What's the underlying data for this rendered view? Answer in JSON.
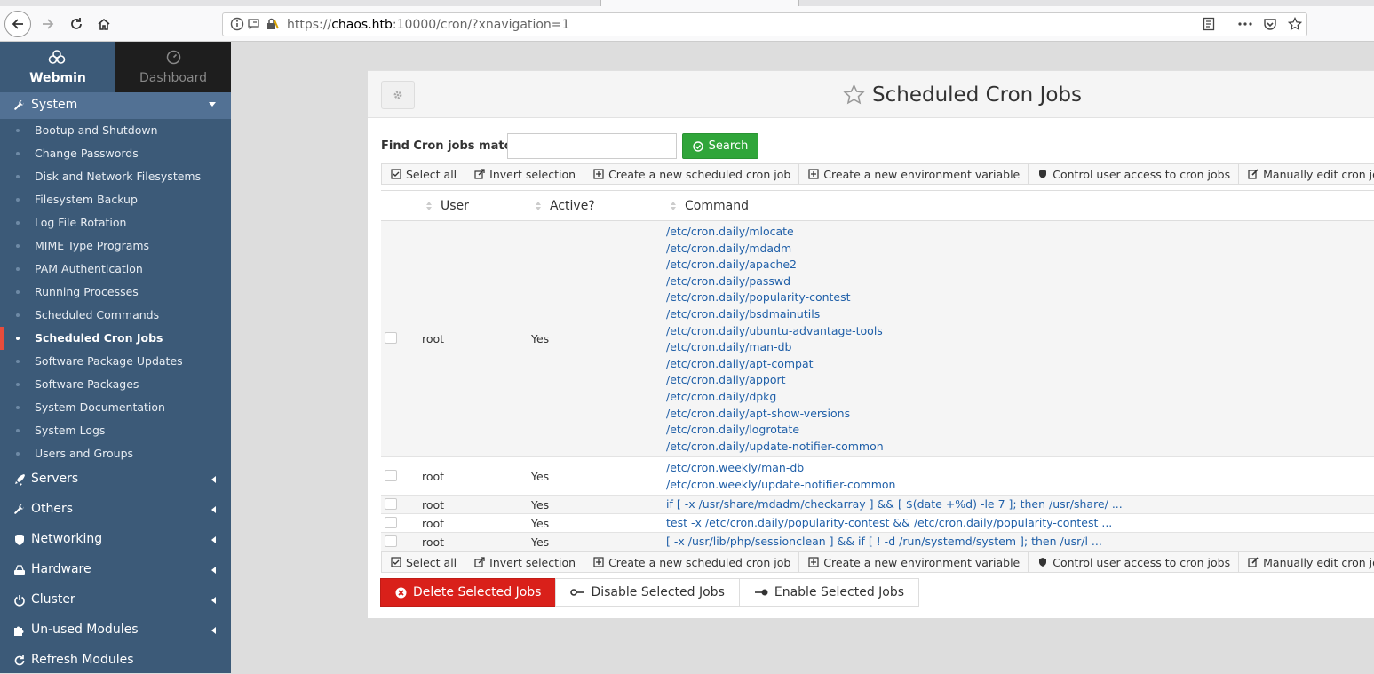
{
  "browser": {
    "url_scheme": "https://",
    "url_host": "chaos.htb",
    "url_rest": ":10000/cron/?xnavigation=1"
  },
  "sidebar": {
    "tab_webmin": "Webmin",
    "tab_dashboard": "Dashboard",
    "system_label": "System",
    "items": [
      {
        "label": "Bootup and Shutdown"
      },
      {
        "label": "Change Passwords"
      },
      {
        "label": "Disk and Network Filesystems"
      },
      {
        "label": "Filesystem Backup"
      },
      {
        "label": "Log File Rotation"
      },
      {
        "label": "MIME Type Programs"
      },
      {
        "label": "PAM Authentication"
      },
      {
        "label": "Running Processes"
      },
      {
        "label": "Scheduled Commands"
      },
      {
        "label": "Scheduled Cron Jobs"
      },
      {
        "label": "Software Package Updates"
      },
      {
        "label": "Software Packages"
      },
      {
        "label": "System Documentation"
      },
      {
        "label": "System Logs"
      },
      {
        "label": "Users and Groups"
      }
    ],
    "categories": [
      {
        "label": "Servers",
        "icon": "rocket-icon"
      },
      {
        "label": "Others",
        "icon": "wrench-icon"
      },
      {
        "label": "Networking",
        "icon": "shield-icon"
      },
      {
        "label": "Hardware",
        "icon": "hdd-icon"
      },
      {
        "label": "Cluster",
        "icon": "power-icon"
      },
      {
        "label": "Un-used Modules",
        "icon": "puzzle-icon"
      },
      {
        "label": "Refresh Modules",
        "icon": "refresh-icon"
      }
    ]
  },
  "main": {
    "title": "Scheduled Cron Jobs",
    "find_label": "Find Cron jobs matching",
    "search_value": "",
    "search_button": "Search",
    "toolbar": {
      "select_all": "Select all",
      "invert": "Invert selection",
      "new_job": "Create a new scheduled cron job",
      "new_env": "Create a new environment variable",
      "control": "Control user access to cron jobs",
      "manual": "Manually edit cron jobs"
    },
    "columns": {
      "user": "User",
      "active": "Active?",
      "command": "Command"
    },
    "rows": [
      {
        "user": "root",
        "active": "Yes",
        "commands": [
          "/etc/cron.daily/mlocate",
          "/etc/cron.daily/mdadm",
          "/etc/cron.daily/apache2",
          "/etc/cron.daily/passwd",
          "/etc/cron.daily/popularity-contest",
          "/etc/cron.daily/bsdmainutils",
          "/etc/cron.daily/ubuntu-advantage-tools",
          "/etc/cron.daily/man-db",
          "/etc/cron.daily/apt-compat",
          "/etc/cron.daily/apport",
          "/etc/cron.daily/dpkg",
          "/etc/cron.daily/apt-show-versions",
          "/etc/cron.daily/logrotate",
          "/etc/cron.daily/update-notifier-common"
        ]
      },
      {
        "user": "root",
        "active": "Yes",
        "commands": [
          "/etc/cron.weekly/man-db",
          "/etc/cron.weekly/update-notifier-common"
        ]
      },
      {
        "user": "root",
        "active": "Yes",
        "commands": [
          "if [ -x /usr/share/mdadm/checkarray ] && [ $(date +%d) -le 7 ]; then /usr/share/ ..."
        ]
      },
      {
        "user": "root",
        "active": "Yes",
        "commands": [
          "test -x /etc/cron.daily/popularity-contest && /etc/cron.daily/popularity-contest ..."
        ]
      },
      {
        "user": "root",
        "active": "Yes",
        "commands": [
          "[ -x /usr/lib/php/sessionclean ] && if [ ! -d /run/systemd/system ]; then /usr/l ..."
        ]
      }
    ],
    "actions": {
      "delete": "Delete Selected Jobs",
      "disable": "Disable Selected Jobs",
      "enable": "Enable Selected Jobs"
    }
  },
  "colors": {
    "sidebar_bg": "#3c5a78",
    "sidebar_active_category": "#527194",
    "search_green": "#30a53a",
    "delete_red": "#d9201a",
    "link_blue": "#1f5fa8",
    "active_marker": "#e74c3c"
  }
}
